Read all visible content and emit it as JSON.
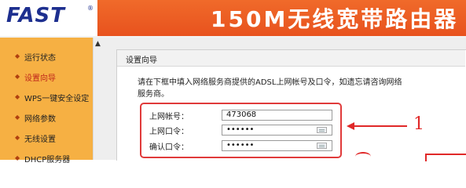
{
  "header": {
    "logo": "FAST",
    "logo_mark": "®",
    "title": "150M无线宽带路由器"
  },
  "sidebar": {
    "items": [
      {
        "label": "运行状态",
        "active": false
      },
      {
        "label": "设置向导",
        "active": true
      },
      {
        "label": "WPS一键安全设定",
        "active": false
      },
      {
        "label": "网络参数",
        "active": false
      },
      {
        "label": "无线设置",
        "active": false
      },
      {
        "label": "DHCP服务器",
        "active": false
      }
    ],
    "scroll_up": "▲"
  },
  "panel": {
    "title": "设置向导",
    "intro_line1": "请在下框中填入网络服务商提供的ADSL上网帐号及口令，如遗忘请咨询网络",
    "intro_line2": "服务商。",
    "fields": {
      "account_label": "上网帐号：",
      "account_value": "473068",
      "password_label": "上网口令：",
      "password_value": "••••••",
      "confirm_label": "确认口令：",
      "confirm_value": "••••••"
    }
  },
  "annotations": {
    "step1": "1"
  },
  "colors": {
    "header_orange": "#e8521e",
    "sidebar_orange": "#f6b043",
    "logo_blue": "#1d2f8f",
    "annotation_red": "#e02828",
    "active_menu_red": "#c0261b"
  }
}
